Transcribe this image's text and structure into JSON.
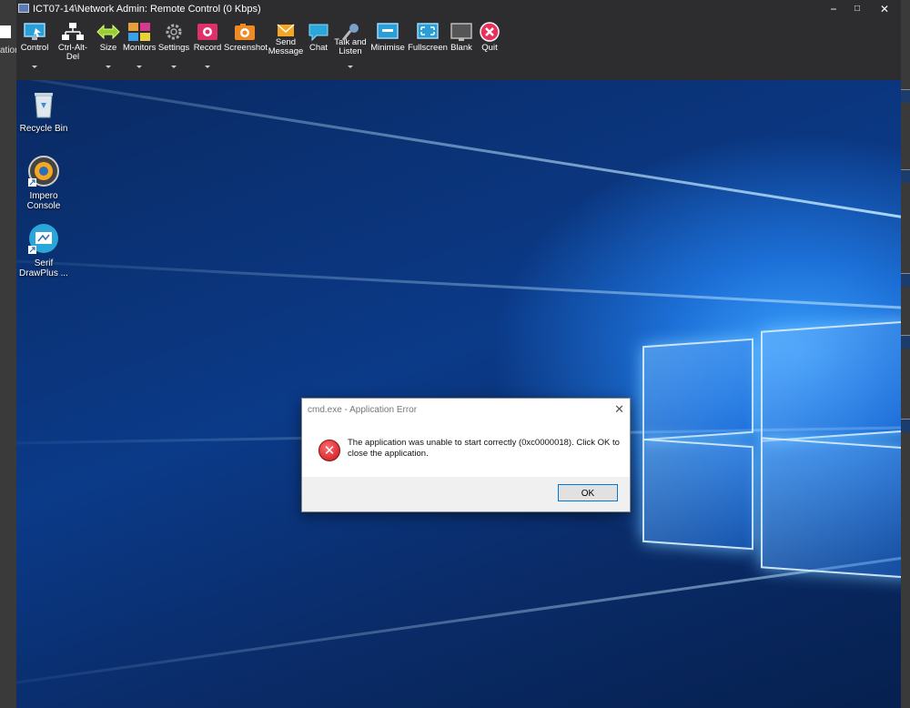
{
  "window": {
    "title": "ICT07-14\\Network Admin: Remote Control (0 Kbps)",
    "minimize": "−",
    "maximize": "□",
    "close": "✕"
  },
  "left_edge_text": "ation",
  "toolbar": {
    "items": [
      {
        "label": "Control",
        "icon": "monitor-control-icon",
        "dropdown": true
      },
      {
        "label": "Ctrl-Alt-Del",
        "icon": "network-icon",
        "dropdown": false
      },
      {
        "label": "Size",
        "icon": "resize-arrows-icon",
        "dropdown": true
      },
      {
        "label": "Monitors",
        "icon": "monitors-grid-icon",
        "dropdown": true
      },
      {
        "label": "Settings",
        "icon": "gear-icon",
        "dropdown": true
      },
      {
        "label": "Record",
        "icon": "record-icon",
        "dropdown": true
      },
      {
        "label": "Screenshot",
        "icon": "camera-icon",
        "dropdown": false
      },
      {
        "label": "Send Message",
        "icon": "envelope-icon",
        "dropdown": false
      },
      {
        "label": "Chat",
        "icon": "chat-bubble-icon",
        "dropdown": false
      },
      {
        "label": "Talk and Listen",
        "icon": "microphone-icon",
        "dropdown": true
      },
      {
        "label": "Minimise",
        "icon": "minimise-icon",
        "dropdown": false
      },
      {
        "label": "Fullscreen",
        "icon": "fullscreen-icon",
        "dropdown": false
      },
      {
        "label": "Blank",
        "icon": "blank-screen-icon",
        "dropdown": false
      },
      {
        "label": "Quit",
        "icon": "quit-icon",
        "dropdown": false
      }
    ]
  },
  "desktop": {
    "icons": [
      {
        "label": "Recycle Bin",
        "icon": "recycle-bin-icon"
      },
      {
        "label": "Impero Console",
        "icon": "impero-console-icon"
      },
      {
        "label": "Serif DrawPlus ...",
        "icon": "drawplus-icon"
      }
    ]
  },
  "dialog": {
    "title": "cmd.exe - Application Error",
    "close": "✕",
    "message": "The application was unable to start correctly (0xc0000018). Click OK to close the application.",
    "ok_label": "OK",
    "icon": "error-icon"
  }
}
